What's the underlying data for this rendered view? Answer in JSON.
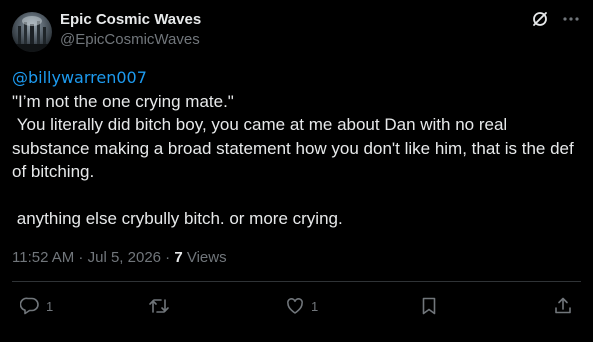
{
  "author": {
    "display_name": "Epic Cosmic Waves",
    "handle": "@EpicCosmicWaves"
  },
  "top_icons": [
    "grok-icon",
    "more-icon"
  ],
  "post": {
    "mention": "@billywarren007",
    "lines": [
      "\"I’m not the one crying mate.\"",
      " You literally did bitch boy, you came at me about Dan with no real substance making a broad statement how you don't like him, that is the def of bitching.",
      "",
      " anything else crybully bitch. or more crying."
    ]
  },
  "meta": {
    "time": "11:52 AM",
    "separator": " · ",
    "date": "Jul 5, 2026",
    "views_count": "7",
    "views_label": "Views"
  },
  "actions": {
    "reply_count": "1",
    "repost_count": "",
    "like_count": "1"
  },
  "colors": {
    "background": "#000000",
    "text": "#e7e9ea",
    "secondary": "#71767b",
    "link": "#1d9bf0",
    "divider": "#2f3336"
  }
}
